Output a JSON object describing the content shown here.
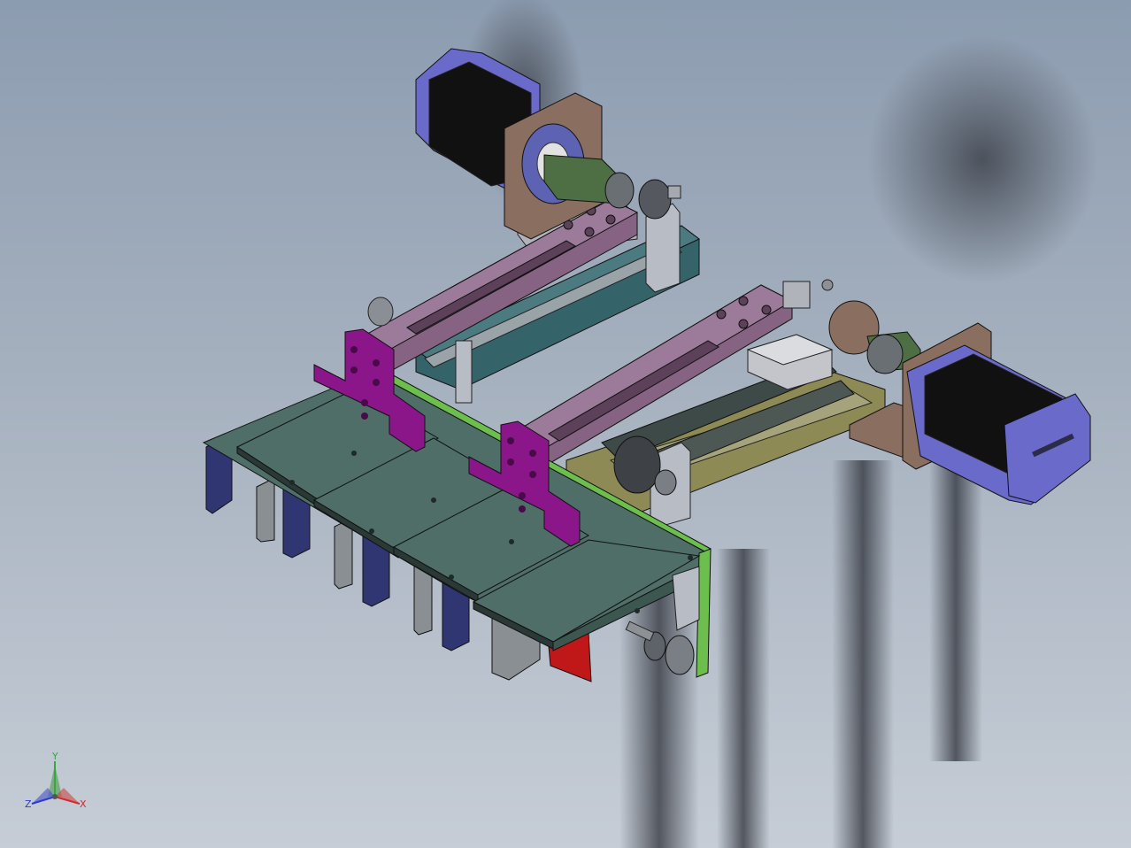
{
  "triad": {
    "x_label": "X",
    "y_label": "Y",
    "z_label": "Z",
    "x_color": "#d42a2a",
    "y_color": "#2fae2f",
    "z_color": "#2a3bd4"
  },
  "colors": {
    "motor_body": "#111111",
    "motor_cap": "#6a6acb",
    "slider_plate": "#876383",
    "bracket": "#8a168a",
    "tray_plate": "#4f6e68",
    "frame_border": "#6cbf4c",
    "rail_base": "#34636a",
    "flange": "#8a6e60",
    "coupling": "#4e6e44",
    "mount_plate": "#8d8a55",
    "red_tab": "#c01818"
  },
  "icons": {
    "triad": "axis-triad-icon",
    "motor_left": "stepper-motor-icon",
    "motor_right": "stepper-motor-icon"
  }
}
